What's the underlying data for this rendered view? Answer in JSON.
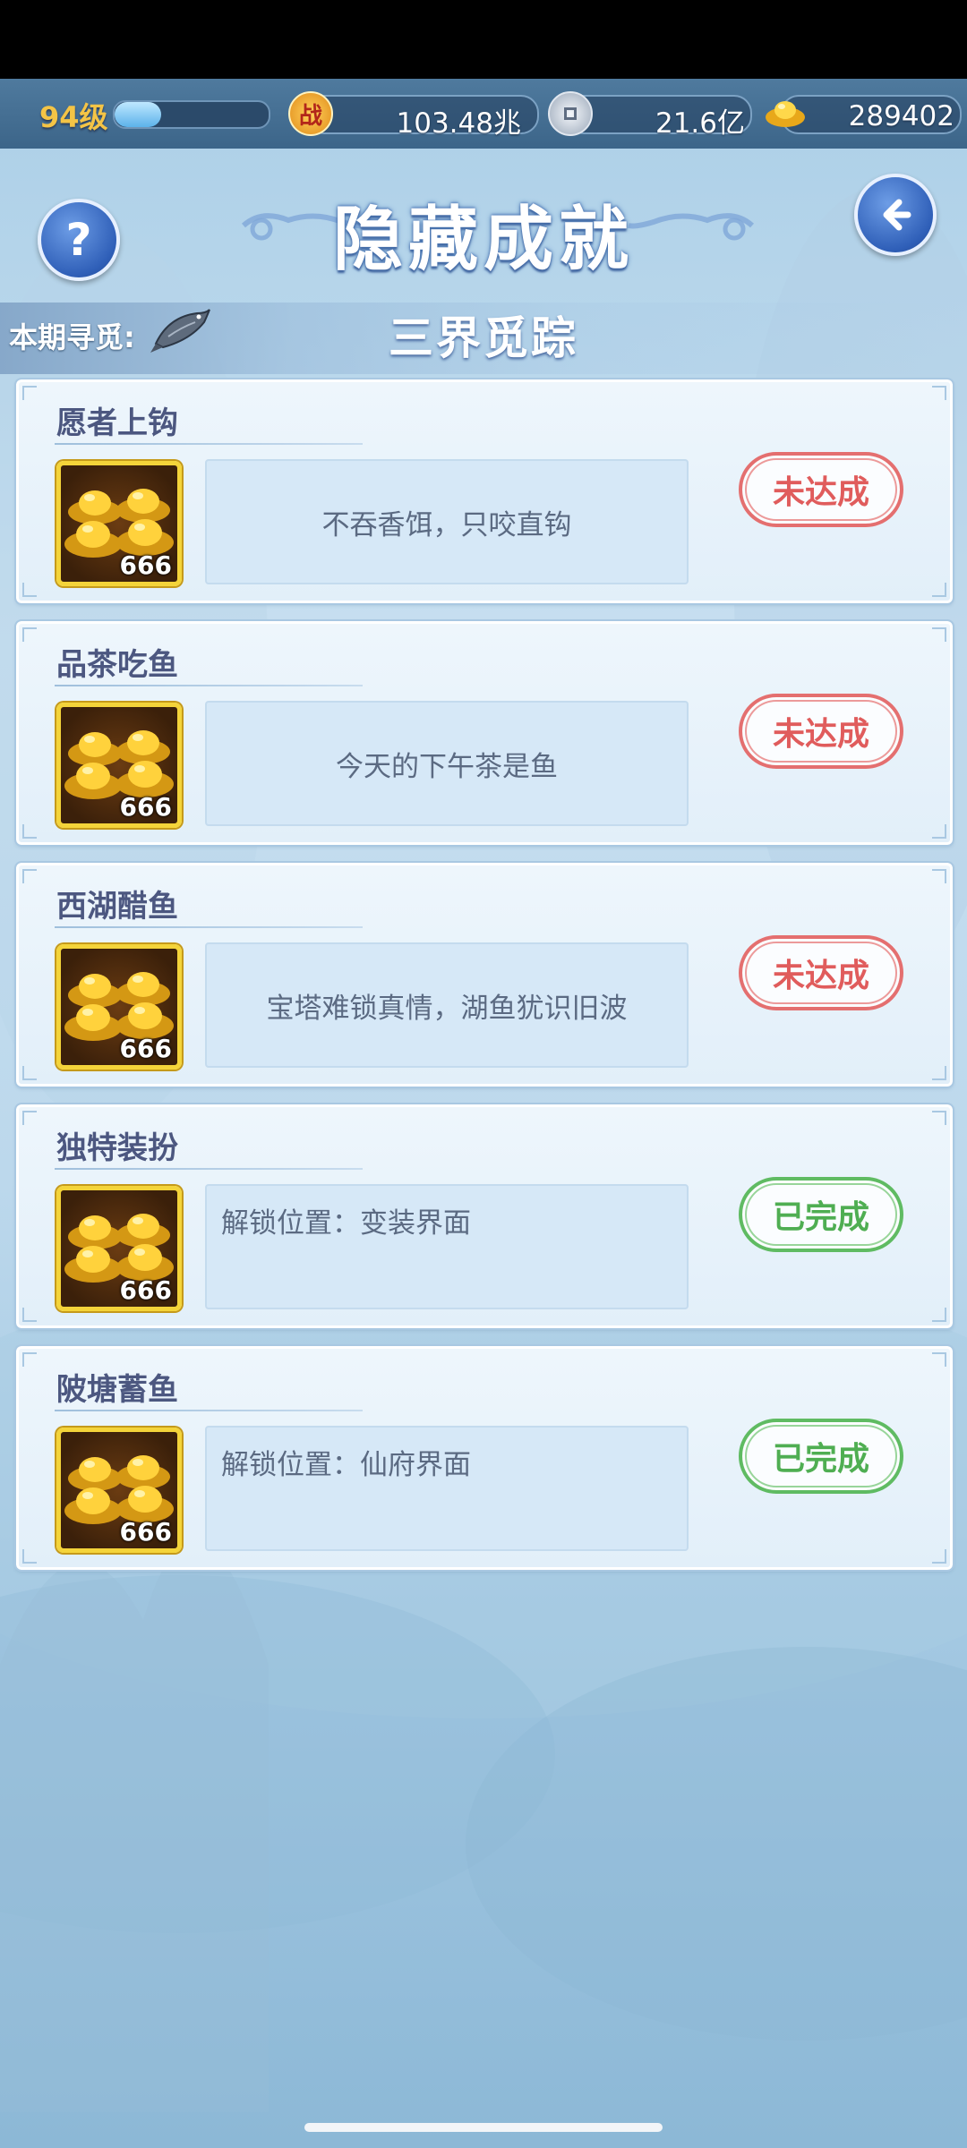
{
  "topbar": {
    "level": "94级",
    "exp_fraction": 0.3,
    "power_icon_char": "战",
    "power_value": "103.48兆",
    "coin_value": "21.6亿",
    "ingot_value": "289402"
  },
  "header": {
    "title": "隐藏成就",
    "help_label": "?",
    "period_label": "本期寻觅:",
    "period_name": "三界觅踪"
  },
  "achievements": [
    {
      "title": "愿者上钩",
      "qty": "666",
      "desc": "不吞香饵，只咬直钩",
      "status": "未达成",
      "done": false
    },
    {
      "title": "品茶吃鱼",
      "qty": "666",
      "desc": "今天的下午茶是鱼",
      "status": "未达成",
      "done": false
    },
    {
      "title": "西湖醋鱼",
      "qty": "666",
      "desc": "宝塔难锁真情，湖鱼犹识旧波",
      "status": "未达成",
      "done": false
    },
    {
      "title": "独特装扮",
      "qty": "666",
      "desc": "解锁位置：变装界面",
      "status": "已完成",
      "done": true
    },
    {
      "title": "陂塘蓄鱼",
      "qty": "666",
      "desc": "解锁位置：仙府界面",
      "status": "已完成",
      "done": true
    }
  ],
  "colors": {
    "not_done": "#e05c5c",
    "done": "#4fae52",
    "title_text": "#4c5780"
  }
}
